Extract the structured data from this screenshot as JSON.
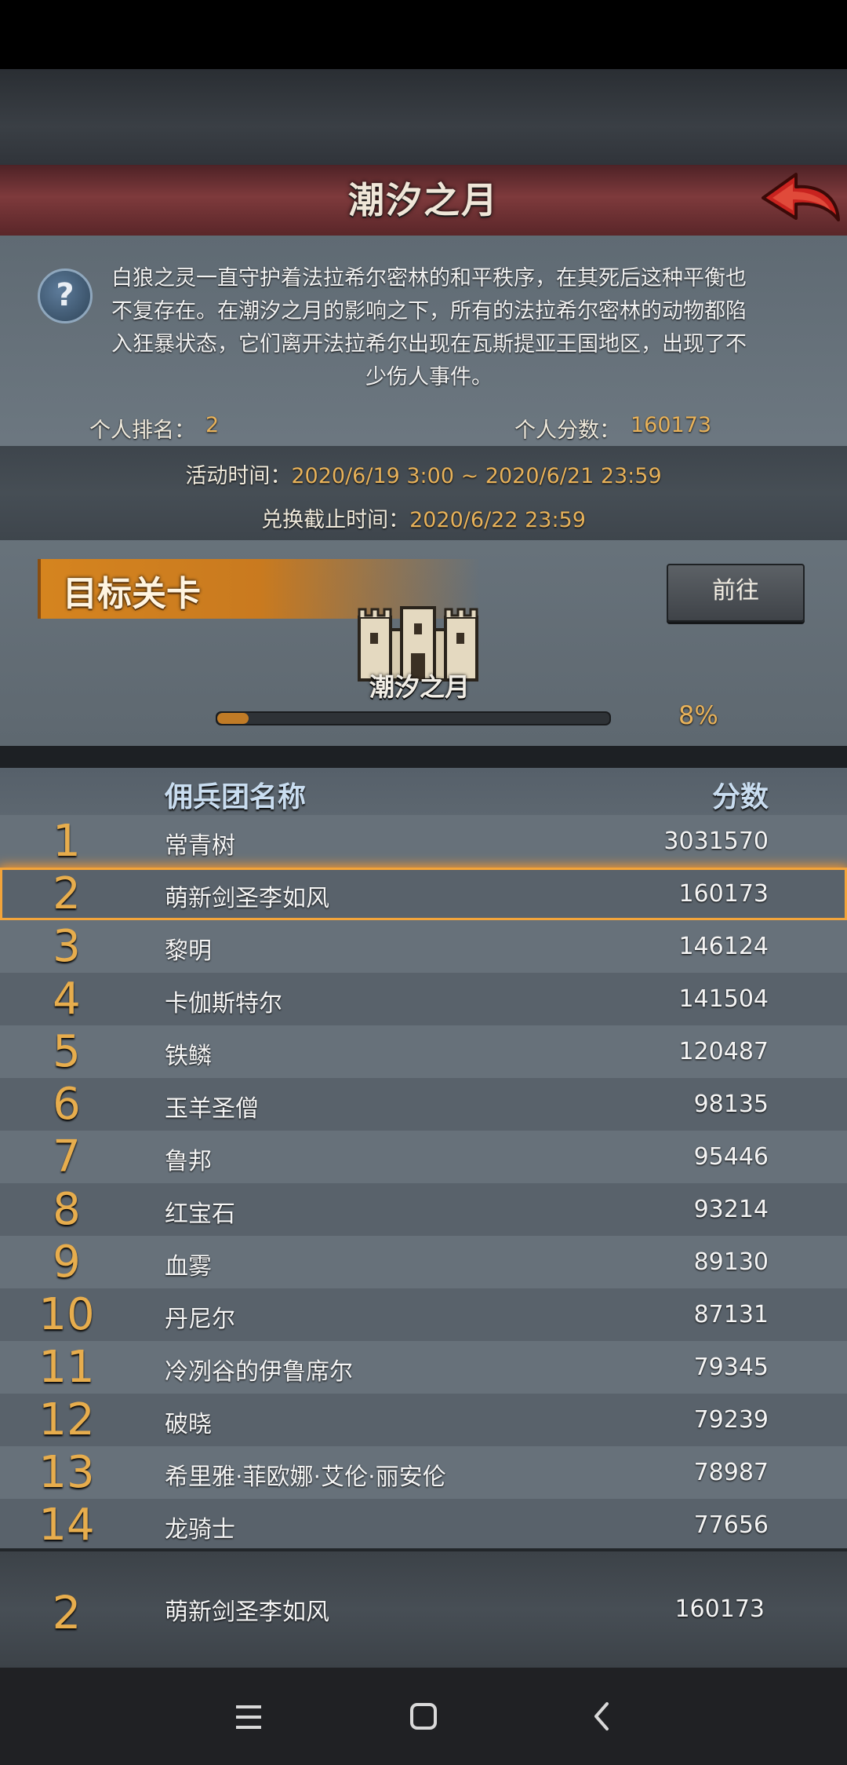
{
  "header": {
    "title": "潮汐之月"
  },
  "description": "白狼之灵一直守护着法拉希尔密林的和平秩序，在其死后这种平衡也不复存在。在潮汐之月的影响之下，所有的法拉希尔密林的动物都陷入狂暴状态，它们离开法拉希尔出现在瓦斯提亚王国地区，出现了不少伤人事件。",
  "stats": {
    "rank_label": "个人排名：",
    "rank_value": "2",
    "score_label": "个人分数：",
    "score_value": "160173"
  },
  "event": {
    "time_label": "活动时间：",
    "time_value": "2020/6/19 3:00 ~ 2020/6/21 23:59",
    "deadline_label": "兑换截止时间：",
    "deadline_value": "2020/6/22 23:59"
  },
  "target": {
    "title": "目标关卡",
    "go_label": "前往",
    "stage_name": "潮汐之月",
    "progress_text": "8%",
    "progress": 0.08
  },
  "table": {
    "header_name": "佣兵团名称",
    "header_score": "分数",
    "rows": [
      {
        "rank": "1",
        "name": "常青树",
        "score": "3031570"
      },
      {
        "rank": "2",
        "name": "萌新剑圣李如风",
        "score": "160173"
      },
      {
        "rank": "3",
        "name": "黎明",
        "score": "146124"
      },
      {
        "rank": "4",
        "name": "卡伽斯特尔",
        "score": "141504"
      },
      {
        "rank": "5",
        "name": "铁鳞",
        "score": "120487"
      },
      {
        "rank": "6",
        "name": "玉羊圣僧",
        "score": "98135"
      },
      {
        "rank": "7",
        "name": "鲁邦",
        "score": "95446"
      },
      {
        "rank": "8",
        "name": "红宝石",
        "score": "93214"
      },
      {
        "rank": "9",
        "name": "血雾",
        "score": "89130"
      },
      {
        "rank": "10",
        "name": "丹尼尔",
        "score": "87131"
      },
      {
        "rank": "11",
        "name": "冷冽谷的伊鲁席尔",
        "score": "79345"
      },
      {
        "rank": "12",
        "name": "破晓",
        "score": "79239"
      },
      {
        "rank": "13",
        "name": "希里雅·菲欧娜·艾伦·丽安伦",
        "score": "78987"
      },
      {
        "rank": "14",
        "name": "龙骑士",
        "score": "77656"
      }
    ],
    "highlight_rank": "2"
  },
  "my_entry": {
    "rank": "2",
    "name": "萌新剑圣李如风",
    "score": "160173"
  },
  "icons": {
    "back": "back-arrow-icon",
    "help": "question-icon",
    "castle": "castle-icon",
    "nav_menu": "menu-icon",
    "nav_home": "home-square-icon",
    "nav_back": "chevron-left-icon"
  },
  "colors": {
    "accent_gold": "#e8b25a",
    "title_bar": "#7e3a3c",
    "banner_orange": "#d5841f",
    "highlight_glow": "#ff9a2a"
  }
}
